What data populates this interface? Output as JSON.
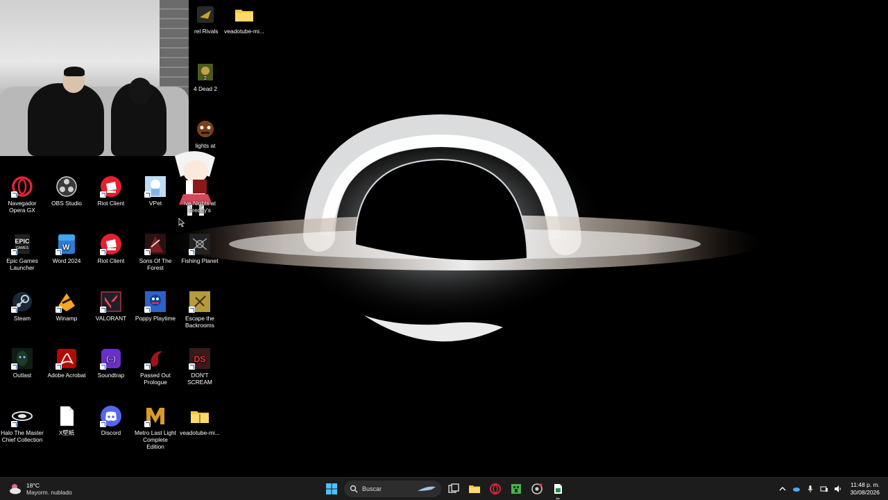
{
  "desktop": {
    "icons": [
      {
        "id": "marvel-rivals",
        "label": "rel Rivals",
        "color": "#c9a227"
      },
      {
        "id": "veadotube-top",
        "label": "veadotube-mi...",
        "color": "#f2c744"
      },
      {
        "id": "left4dead2",
        "label": "4 Dead 2",
        "color": "#6b7d2b"
      },
      {
        "id": "fnaf",
        "label": "lights at",
        "color": "#8a4b1e"
      },
      {
        "id": "opera-gx",
        "label": "Navegador Opera GX",
        "color": "#e0243a"
      },
      {
        "id": "obs",
        "label": "OBS Studio",
        "color": "#333333"
      },
      {
        "id": "riot-1",
        "label": "Riot Client",
        "color": "#e5202e"
      },
      {
        "id": "vpet",
        "label": "VPet",
        "color": "#7fb6e8"
      },
      {
        "id": "fnaf-2",
        "label": "ive Nights at Freddy's",
        "color": "#8a1a1a"
      },
      {
        "id": "epic",
        "label": "Epic Games Launcher",
        "color": "#222222"
      },
      {
        "id": "word",
        "label": "Word 2024",
        "color": "#2b7cd3"
      },
      {
        "id": "riot-2",
        "label": "Riot Client",
        "color": "#e5202e"
      },
      {
        "id": "sons",
        "label": "Sons Of The Forest",
        "color": "#7a1d1d"
      },
      {
        "id": "fishing",
        "label": "Fishing Planet",
        "color": "#2b2b2b"
      },
      {
        "id": "steam",
        "label": "Steam",
        "color": "#1b2838"
      },
      {
        "id": "winamp",
        "label": "Winamp",
        "color": "#f5a623"
      },
      {
        "id": "valorant",
        "label": "VALORANT",
        "color": "#fd4556"
      },
      {
        "id": "poppy",
        "label": "Poppy Playtime",
        "color": "#2d62c8"
      },
      {
        "id": "backrooms",
        "label": "Escape the Backrooms",
        "color": "#b59a3e"
      },
      {
        "id": "outlast",
        "label": "Outlast",
        "color": "#1f3a28"
      },
      {
        "id": "acrobat",
        "label": "Adobe Acrobat",
        "color": "#b30b00"
      },
      {
        "id": "soundtrap",
        "label": "Soundtrap",
        "color": "#6a2fc7"
      },
      {
        "id": "passed-out",
        "label": "Passed Out Prologue",
        "color": "#a4121a"
      },
      {
        "id": "dont-scream",
        "label": "DON'T SCREAM",
        "color": "#3a1a1a"
      },
      {
        "id": "halo",
        "label": "Halo The Master Chief Collection",
        "color": "#555555"
      },
      {
        "id": "xfile",
        "label": "X壁紙",
        "color": "#ffffff"
      },
      {
        "id": "discord",
        "label": "Discord",
        "color": "#5865f2"
      },
      {
        "id": "metro",
        "label": "Metro Last Light Complete Edition",
        "color": "#d89b2a"
      },
      {
        "id": "veadotube-bottom",
        "label": "veadotube-mi...",
        "color": "#f2c744"
      }
    ]
  },
  "taskbar": {
    "weather": {
      "temp": "18°C",
      "desc": "Mayorm. nublado"
    },
    "search_placeholder": "Buscar",
    "clock": {
      "time": "11:48 p. m.",
      "date": "30/08/2026"
    }
  }
}
